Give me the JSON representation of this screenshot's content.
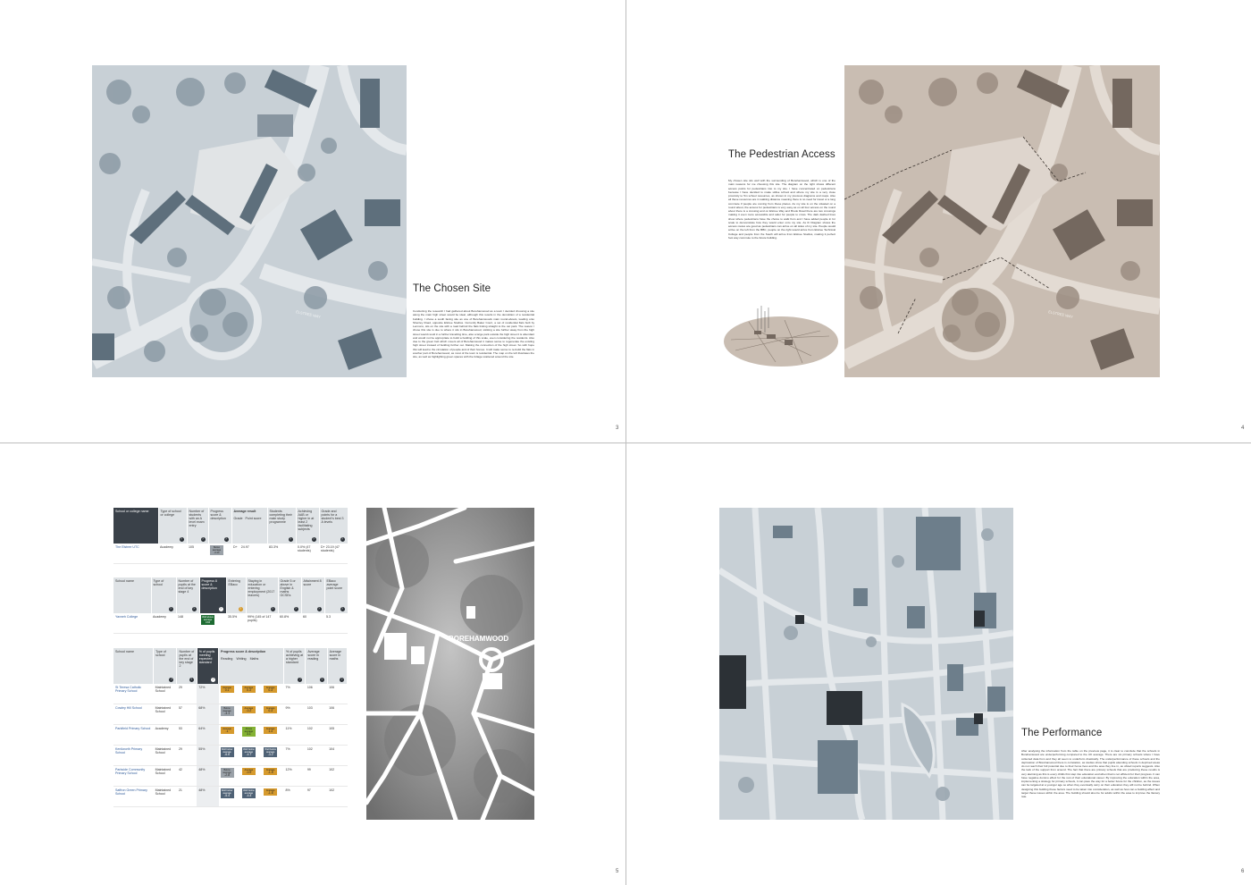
{
  "pages": {
    "p3": {
      "title": "The Chosen Site",
      "body": "Conducting the research I had gathered about Borehamwood as a town I decided choosing a site along the main high street would be ideal, although this results in the demolition of a residential building. I chose a south facing site as one of Borehamwoods main round-abouts, leading onto Shenley Road, opposite Elstree Studios. Currently Baker Court, a set of residential flats built by Lennons, sits on the site with a road behind the flats linking straight to the car park. The reason I chose this site is due to where it sits in Borehamwood, sticking a site further away from the high street would result in a further travelling time, also a large park outside the high street it is abundant and would not be appropriate to build a building of this scale, even considering the residents. Also due to the green belt which covers all of Borehamwood it makes sense to regenerate the existing high street instead of building further out. Making the connection of the high street. So with hope this will lead to the circulation of people and of their homes. It will make sense to re-build the flats in another part of Borehamwood, as most of the town is residential. The map on the left illustrates the site, as well as highlighting green spaces with the foliage scattered around the site.",
      "page_number": "3",
      "street_label": "ELSTREE WAY"
    },
    "p4": {
      "title": "The Pedestrian Access",
      "body": "My chosen site sits well with the surrounding of Borehamwood, which is one of the main reasons for me choosing this site. The diagram on the right shows different access points for pedestrians into to my site. I have concentrated on pedestrians because I have decided to make utilise school and where my site is a very close proximity to 5m school resources, as shown in my previous diagrams and maps. Also all these resources are in walking distance meaning there is no need for travel or a long commute if people are coming from these places. As my site is on the situated on a round about, the access for pedestrians is very easy as on all four access on the round about there is a crossing and on Elstree Way and Brook Road there are two crossings making it even more accessible and safer for people to cross. The dark dashed lines show where pedestrians have the choice to walk from and I have added people in for scale to demonstrate how they would enter onto my site. As th Diagram shows the access routes are good as pedestrians can arrive on all sides of my site. People would arrive on the left from the BBC, people on the right would arrive from Elstree Technical College and people from the South will arrive from Elstree Studios, making it perfect foot way commute to the future building.",
      "page_number": "4",
      "street_label": "ELSTREE WAY"
    },
    "p5": {
      "page_number": "5",
      "map_label": "BOREHAMWOOD",
      "table1": {
        "headers": [
          "School or college name",
          "Type of school or college",
          "Number of students with an A level exam entry",
          "Progress score & description",
          "Average result",
          "Students completing their main study programme",
          "Achieving AAB or higher in at least 2 facilitating subjects",
          "Grade and points for a student's best 3 A levels"
        ],
        "sub_headers": [
          "Grade",
          "Point score"
        ],
        "rows": [
          {
            "name": "The Elstree UTC",
            "type": "Academy",
            "entries": "105",
            "badge": "Below average -0.44",
            "grade": "D+",
            "points": "24.97",
            "completing": "83.3%",
            "aab": "0.0% (47 students)",
            "best3": "D+ 23.19 (47 students)"
          }
        ]
      },
      "table2": {
        "headers": [
          "School name",
          "Type of school",
          "Number of pupils at the end of key stage 4",
          "Progress 8 score & description",
          "Entering EBacc",
          "Staying in education or entering employment (2017 leavers)",
          "Grade 5 or above in English & maths GCSEs",
          "Attainment 8 score",
          "EBacc average point score"
        ],
        "rows": [
          {
            "name": "Yavneh College",
            "type": "Academy",
            "pupils": "148",
            "badge": "Well above average 0.84",
            "ebacc": "35.5%",
            "staying": "99% (145 of 147 pupils)",
            "grade5": "60.8%",
            "att8": "60",
            "ebacc_score": "5.3"
          }
        ]
      },
      "table3": {
        "headers": [
          "School name",
          "Type of school",
          "Number of pupils at the end of key stage 2",
          "% of pupils meeting expected standard",
          "Progress score & description",
          "% of pupils achieving at a higher standard",
          "Average score in reading",
          "Average score in maths"
        ],
        "sub_headers": [
          "Reading",
          "Writing",
          "Maths"
        ],
        "rows": [
          {
            "name": "St Teresa Catholic Primary School",
            "type": "Maintained School",
            "pupils": "29",
            "pct": "72%",
            "b": [
              [
                "Average",
                "0.1",
                "orange"
              ],
              [
                "Average",
                "0.3",
                "orange"
              ],
              [
                "Average",
                "0.3",
                "orange"
              ]
            ],
            "higher": "7%",
            "reading": "106",
            "maths": "106"
          },
          {
            "name": "Cowley Hill School",
            "type": "Maintained School",
            "pupils": "57",
            "pct": "68%",
            "b": [
              [
                "Below average",
                "-3.1",
                "grey"
              ],
              [
                "Average",
                "-0.2",
                "orange"
              ],
              [
                "Average",
                "0.3",
                "orange"
              ]
            ],
            "higher": "9%",
            "reading": "103",
            "maths": "106"
          },
          {
            "name": "Parkfield Primary School",
            "type": "Academy",
            "pupils": "53",
            "pct": "64%",
            "b": [
              [
                "Average",
                "-1",
                "orange"
              ],
              [
                "Above average",
                "3.1",
                "green-l"
              ],
              [
                "Average",
                "1.4",
                "orange"
              ]
            ],
            "higher": "11%",
            "reading": "102",
            "maths": "105"
          },
          {
            "name": "Kenilworth Primary School",
            "type": "Maintained School",
            "pupils": "29",
            "pct": "55%",
            "b": [
              [
                "Well below average",
                "-6.6",
                "blue"
              ],
              [
                "Well below average",
                "-4.7",
                "blue"
              ],
              [
                "Well below average",
                "-3.2",
                "blue"
              ]
            ],
            "higher": "7%",
            "reading": "102",
            "maths": "104"
          },
          {
            "name": "Parkside Community Primary School",
            "type": "Maintained School",
            "pupils": "42",
            "pct": "48%",
            "b": [
              [
                "Below average",
                "-2.8",
                "grey"
              ],
              [
                "Average",
                "-0.9",
                "orange"
              ],
              [
                "Average",
                "-1.5",
                "orange"
              ]
            ],
            "higher": "12%",
            "reading": "99",
            "maths": "102"
          },
          {
            "name": "Saffron Green Primary School",
            "type": "Maintained School",
            "pupils": "21",
            "pct": "48%",
            "b": [
              [
                "Well below average",
                "-5.4",
                "blue"
              ],
              [
                "Well below average",
                "-4.4",
                "blue"
              ],
              [
                "Average",
                "-1.6",
                "orange"
              ]
            ],
            "higher": "8%",
            "reading": "97",
            "maths": "102"
          }
        ]
      }
    },
    "p6": {
      "title": "The Performance",
      "body": "After analysing the information from the table on the previous page, it is clear to conclude that the schools in Borehamwood are underperforming compared to the UK average. There are six primary schools where I have collected data from and they all seem to underform drastically. The underperformance of these schools and the deprivation of Borehamwood there is correlation, as studies show that pupils attending schools in deprived areas do not reach their full potential due to their home lives and the area they live in, as ofsted reports suggests. Also the lack of the support from around. The fact that there are primary schools that are producing these results is very alarming as this is every childs first step into education and when that is not efficient for their progress. It can have negative domino effect for the rest of their educational career. By improving the education within the area, implementing a strategy for primary schools, it can pave the way for a better future for the children, as the issues can be targeted at a younger age so when they eventually carry on their education they will not be behind. When designing this building these factors need to be taken into consideration, as well as how can a building affect and target these issues within the area. The building should also be for adults within the area to improve the literacy rate.",
      "page_number": "6"
    }
  },
  "colors": {
    "map_blue_bg": "#c8d0d6",
    "map_blue_roads": "#e4e8eb",
    "map_blue_trees": "#8c9aa5",
    "map_blue_buildings": "#5e6f7c",
    "map_beige_bg": "#c9bdb2",
    "map_beige_roads": "#e3dbd3",
    "map_beige_trees": "#9c8e82",
    "map_beige_buildings": "#74685f",
    "badge_orange": "#d69a2d",
    "badge_grey": "#9aa1a8",
    "badge_blue": "#4f6276",
    "badge_green": "#1d6b32"
  }
}
